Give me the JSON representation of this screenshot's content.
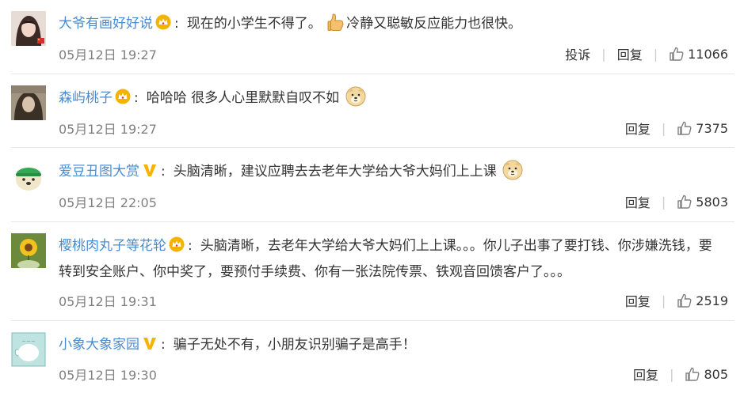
{
  "labels": {
    "report": "投诉",
    "reply": "回复"
  },
  "colors": {
    "username": "#4a8bd0",
    "text": "#333333",
    "time": "#808080",
    "separator": "#cccccc",
    "crown": "#e9a400",
    "vip_v": "#f6b400"
  },
  "comments": [
    {
      "user": "大爷有画好好说",
      "badge": "crown-icon",
      "text_before": "现在的小学生不得了。",
      "emoji_mid": "thumbs-up-emoji",
      "text_after": "冷静又聪敏反应能力也很快。",
      "time": "05月12日 19:27",
      "likes": "11066"
    },
    {
      "user": "森屿桃子",
      "badge": "crown-icon",
      "text": "哈哈哈 很多人心里默默自叹不如",
      "emoji_end": "doge-emoji",
      "time": "05月12日 19:27",
      "likes": "7375"
    },
    {
      "user": "爱豆丑图大赏",
      "badge": "vip-v-icon",
      "text": "头脑清晰，建议应聘去去老年大学给大爷大妈们上上课",
      "emoji_end": "doge-emoji",
      "time": "05月12日 22:05",
      "likes": "5803"
    },
    {
      "user": "樱桃肉丸子等花轮",
      "badge": "crown-icon",
      "text": "头脑清晰，去老年大学给大爷大妈们上上课。。。你儿子出事了要打钱、你涉嫌洗钱，要转到安全账户、你中奖了，要预付手续费、你有一张法院传票、铁观音回馈客户了。。。",
      "time": "05月12日 19:31",
      "likes": "2519"
    },
    {
      "user": "小象大象家园",
      "badge": "vip-v-icon",
      "text": "骗子无处不有，小朋友识别骗子是高手！",
      "time": "05月12日 19:30",
      "likes": "805"
    }
  ]
}
